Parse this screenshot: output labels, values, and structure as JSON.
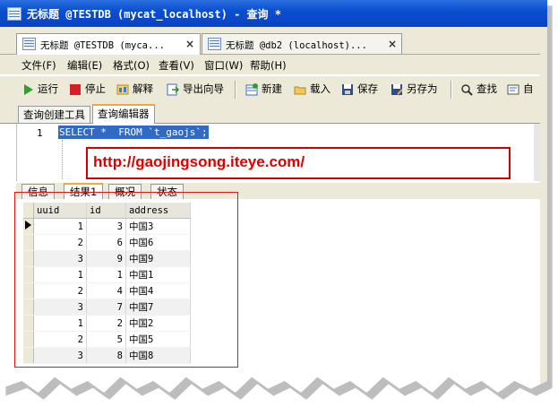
{
  "window": {
    "title": "无标题 @TESTDB (mycat_localhost) - 查询 *"
  },
  "doc_tabs": [
    {
      "label": "无标题 @TESTDB (myca...",
      "close": "×"
    },
    {
      "label": "无标题 @db2 (localhost)...",
      "close": "×"
    }
  ],
  "menu": [
    "文件(F)",
    "编辑(E)",
    "格式(O)",
    "查看(V)",
    "窗口(W)",
    "帮助(H)"
  ],
  "toolbar": {
    "run": "运行",
    "stop": "停止",
    "explain": "解释",
    "export": "导出向导",
    "new": "新建",
    "load": "载入",
    "save": "保存",
    "save_as": "另存为",
    "find": "查找",
    "auto": "自"
  },
  "sub_tabs": [
    "查询创建工具",
    "查询编辑器"
  ],
  "editor": {
    "line": "1",
    "sql": "SELECT *  FROM `t_gaojs`;"
  },
  "annotation_url": "http://gaojingsong.iteye.com/",
  "result_tabs": [
    "信息",
    "结果1",
    "概况",
    "状态"
  ],
  "grid": {
    "columns": [
      "uuid",
      "id",
      "address"
    ],
    "rows": [
      [
        "1",
        "3",
        "中国3"
      ],
      [
        "2",
        "6",
        "中国6"
      ],
      [
        "3",
        "9",
        "中国9"
      ],
      [
        "1",
        "1",
        "中国1"
      ],
      [
        "2",
        "4",
        "中国4"
      ],
      [
        "3",
        "7",
        "中国7"
      ],
      [
        "1",
        "2",
        "中国2"
      ],
      [
        "2",
        "5",
        "中国5"
      ],
      [
        "3",
        "8",
        "中国8"
      ]
    ]
  },
  "colors": {
    "titlebar": "#0a4fd0",
    "selection": "#316ac5",
    "highlight_frame": "#e01818"
  }
}
